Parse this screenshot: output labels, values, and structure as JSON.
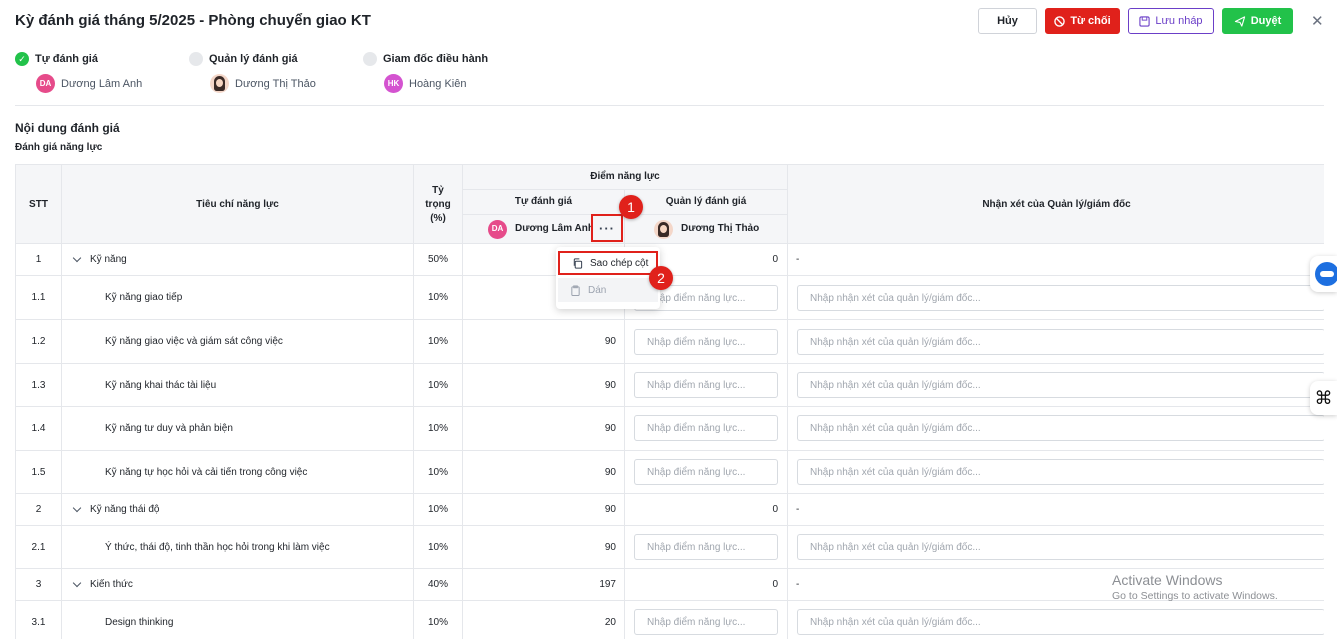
{
  "header": {
    "title": "Kỳ đánh giá tháng 5/2025 - Phòng chuyển giao KT",
    "cancel_label": "Hủy",
    "reject_label": "Từ chối",
    "draft_label": "Lưu nháp",
    "approve_label": "Duyệt",
    "colors": {
      "reject": "#e0211b",
      "draft": "#6b3fc8",
      "approve": "#22c24a"
    }
  },
  "steps": [
    {
      "label": "Tự đánh giá",
      "initials": "DA",
      "name": "Dương Lâm Anh",
      "status": "done"
    },
    {
      "label": "Quản lý đánh giá",
      "initials": "",
      "name": "Dương Thị Thảo",
      "status": "pending"
    },
    {
      "label": "Giam đốc điều hành",
      "initials": "HK",
      "name": "Hoàng Kiên",
      "status": "pending"
    }
  ],
  "section": {
    "title": "Nội dung đánh giá",
    "subtitle": "Đánh giá năng lực"
  },
  "table": {
    "headers": {
      "stt": "STT",
      "criteria": "Tiêu chí năng lực",
      "weight": "Tỷ trọng (%)",
      "score_group": "Điểm năng lực",
      "self": "Tự đánh giá",
      "manager": "Quản lý đánh giá",
      "self_person": "Dương Lâm Anh",
      "self_initials": "DA",
      "manager_person": "Dương Thị Thảo",
      "comment": "Nhận xét của Quản lý/giám đốc"
    },
    "score_placeholder": "Nhập điểm năng lực...",
    "comment_placeholder": "Nhập nhận xét của quản lý/giám đốc...",
    "rows": [
      {
        "stt": "1",
        "name": "Kỹ năng",
        "weight": "50%",
        "self": "",
        "manager": "0",
        "comment": "-",
        "group": true
      },
      {
        "stt": "1.1",
        "name": "Kỹ năng giao tiếp",
        "weight": "10%",
        "self": "",
        "group": false
      },
      {
        "stt": "1.2",
        "name": "Kỹ năng giao việc và giám sát công việc",
        "weight": "10%",
        "self": "90",
        "group": false
      },
      {
        "stt": "1.3",
        "name": "Kỹ năng khai thác tài liệu",
        "weight": "10%",
        "self": "90",
        "group": false
      },
      {
        "stt": "1.4",
        "name": "Kỹ năng tư duy và phản biện",
        "weight": "10%",
        "self": "90",
        "group": false
      },
      {
        "stt": "1.5",
        "name": "Kỹ năng tự học hỏi và cải tiến trong công việc",
        "weight": "10%",
        "self": "90",
        "group": false
      },
      {
        "stt": "2",
        "name": "Kỹ năng thái độ",
        "weight": "10%",
        "self": "90",
        "manager": "0",
        "comment": "-",
        "group": true
      },
      {
        "stt": "2.1",
        "name": "Ý thức, thái độ, tinh thần học hỏi trong khi làm việc",
        "weight": "10%",
        "self": "90",
        "group": false
      },
      {
        "stt": "3",
        "name": "Kiến thức",
        "weight": "40%",
        "self": "197",
        "manager": "0",
        "comment": "-",
        "group": true
      },
      {
        "stt": "3.1",
        "name": "Design thinking",
        "weight": "10%",
        "self": "20",
        "group": false
      }
    ]
  },
  "column_menu": {
    "more_label": "···",
    "copy_label": "Sao chép cột",
    "paste_label": "Dán"
  },
  "annotations": {
    "badge1": "1",
    "badge2": "2"
  },
  "watermark": {
    "line1": "Activate Windows",
    "line2": "Go to Settings to activate Windows."
  }
}
